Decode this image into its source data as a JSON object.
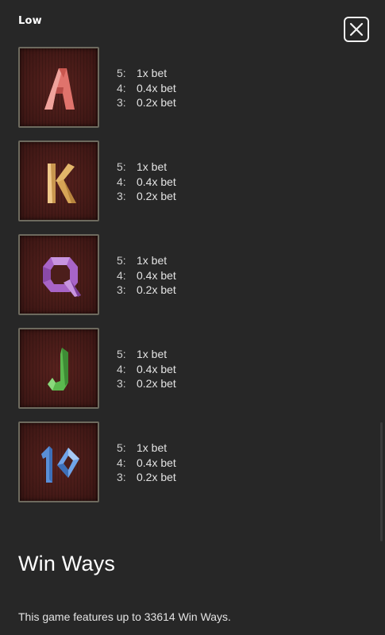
{
  "section": {
    "title": "Low"
  },
  "close_button": {
    "icon": "close-icon"
  },
  "symbols": [
    {
      "name": "A",
      "color": "#e0736c",
      "pays": [
        {
          "count": "5:",
          "value": "1x bet"
        },
        {
          "count": "4:",
          "value": "0.4x bet"
        },
        {
          "count": "3:",
          "value": "0.2x bet"
        }
      ]
    },
    {
      "name": "K",
      "color": "#e3b66a",
      "pays": [
        {
          "count": "5:",
          "value": "1x bet"
        },
        {
          "count": "4:",
          "value": "0.4x bet"
        },
        {
          "count": "3:",
          "value": "0.2x bet"
        }
      ]
    },
    {
      "name": "Q",
      "color": "#a864c7",
      "pays": [
        {
          "count": "5:",
          "value": "1x bet"
        },
        {
          "count": "4:",
          "value": "0.4x bet"
        },
        {
          "count": "3:",
          "value": "0.2x bet"
        }
      ]
    },
    {
      "name": "J",
      "color": "#5bb84e",
      "pays": [
        {
          "count": "5:",
          "value": "1x bet"
        },
        {
          "count": "4:",
          "value": "0.4x bet"
        },
        {
          "count": "3:",
          "value": "0.2x bet"
        }
      ]
    },
    {
      "name": "10",
      "color": "#5a8fd8",
      "pays": [
        {
          "count": "5:",
          "value": "1x bet"
        },
        {
          "count": "4:",
          "value": "0.4x bet"
        },
        {
          "count": "3:",
          "value": "0.2x bet"
        }
      ]
    }
  ],
  "win_ways": {
    "heading": "Win Ways",
    "description": "This game features up to 33614 Win Ways."
  }
}
